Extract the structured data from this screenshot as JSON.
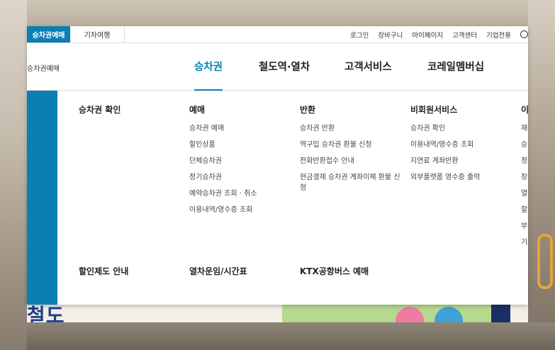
{
  "topbar": {
    "active_tab": "승차권예매",
    "tab2": "기차여행",
    "util": [
      "로그인",
      "장바구니",
      "마이페이지",
      "고객센터",
      "기업전용"
    ]
  },
  "logo_text": "승차권예매",
  "nav": [
    "승차권",
    "철도역·열차",
    "고객서비스",
    "코레일멤버십"
  ],
  "columns": [
    {
      "head": "승차권 확인",
      "items": []
    },
    {
      "head": "예매",
      "items": [
        "승차권 예매",
        "할인상품",
        "단체승차권",
        "정기승차권",
        "예약승차권 조회 · 취소",
        "이용내역/영수증 조회"
      ]
    },
    {
      "head": "반환",
      "items": [
        "승차권 반환",
        "역구입 승차권 환불 신청",
        "전화반환접수 안내",
        "현금결제 승차권 계좌이체 환불 신청"
      ]
    },
    {
      "head": "비회원서비스",
      "items": [
        "승차권 확인",
        "이용내역/영수증 조회",
        "지연료 계좌반환",
        "외부플랫폼 영수증 출력"
      ]
    }
  ],
  "clipped_column": {
    "head": "이",
    "items": [
      "재",
      "승",
      "정",
      "장",
      "열",
      "할",
      "부",
      "기"
    ]
  },
  "bottom_heads": [
    "할인제도 안내",
    "열차운임/시간표",
    "KTX공항버스 예매"
  ],
  "background_text": "철도",
  "colors": {
    "accent": "#0a7fb3"
  }
}
